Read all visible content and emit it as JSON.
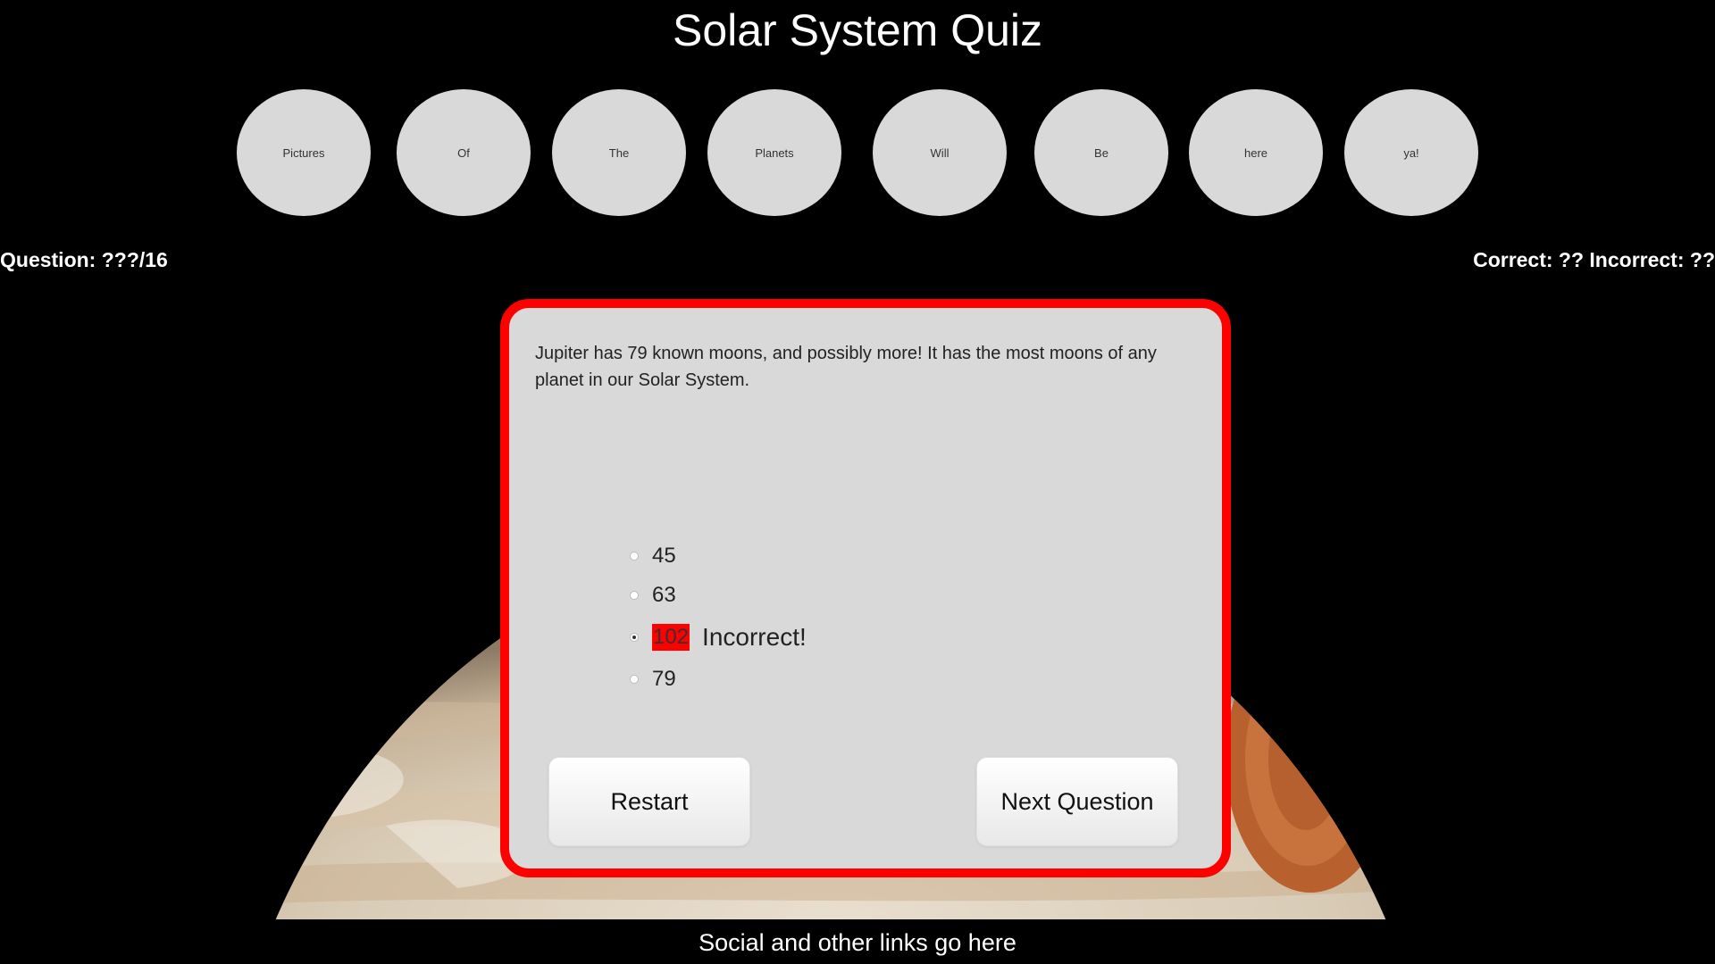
{
  "header": {
    "title": "Solar System Quiz"
  },
  "planets": [
    {
      "label": "Pictures"
    },
    {
      "label": "Of"
    },
    {
      "label": "The"
    },
    {
      "label": "Planets"
    },
    {
      "label": "Will"
    },
    {
      "label": "Be"
    },
    {
      "label": "here"
    },
    {
      "label": "ya!"
    }
  ],
  "stats": {
    "question_counter": "Question: ???/16",
    "score": "Correct: ?? Incorrect: ??"
  },
  "quiz": {
    "question": "Jupiter has 79 known moons, and possibly more!  It has the most moons of any planet in our Solar System.",
    "answers": [
      {
        "label": "45",
        "selected": false
      },
      {
        "label": "63",
        "selected": false
      },
      {
        "label": "102",
        "selected": true,
        "feedback": "Incorrect!"
      },
      {
        "label": "79",
        "selected": false
      }
    ],
    "restart_label": "Restart",
    "next_label": "Next Question"
  },
  "footer": {
    "text": "Social and other links go here"
  },
  "colors": {
    "background": "#000000",
    "card_border": "#ff0000",
    "card_background": "#d9d9d9",
    "incorrect_highlight": "#ff0000"
  }
}
